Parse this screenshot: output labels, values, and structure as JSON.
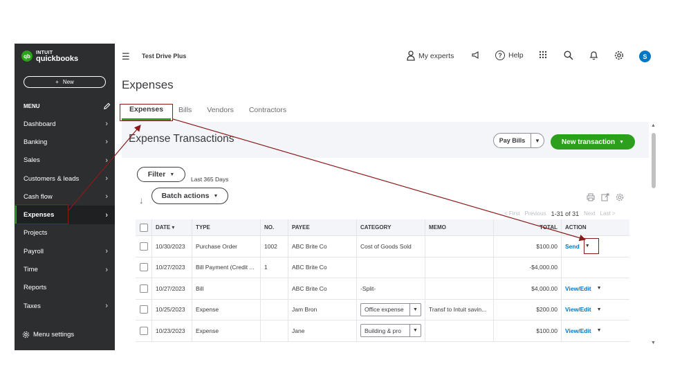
{
  "sidebar": {
    "logo_intuit": "INTUIT",
    "logo_product": "quickbooks",
    "logo_mark": "qb",
    "new_label": "New",
    "menu_label": "MENU",
    "items": [
      {
        "label": "Dashboard",
        "has_chevron": true
      },
      {
        "label": "Banking",
        "has_chevron": true
      },
      {
        "label": "Sales",
        "has_chevron": true
      },
      {
        "label": "Customers & leads",
        "has_chevron": true
      },
      {
        "label": "Cash flow",
        "has_chevron": true
      },
      {
        "label": "Expenses",
        "has_chevron": true,
        "active": true
      },
      {
        "label": "Projects",
        "has_chevron": false
      },
      {
        "label": "Payroll",
        "has_chevron": true
      },
      {
        "label": "Time",
        "has_chevron": true
      },
      {
        "label": "Reports",
        "has_chevron": false
      },
      {
        "label": "Taxes",
        "has_chevron": true
      }
    ],
    "menu_settings": "Menu settings"
  },
  "topbar": {
    "company": "Test Drive Plus",
    "my_experts": "My experts",
    "help": "Help",
    "avatar_letter": "S"
  },
  "page": {
    "title": "Expenses",
    "tabs": [
      "Expenses",
      "Bills",
      "Vendors",
      "Contractors"
    ],
    "active_tab": "Expenses"
  },
  "panel": {
    "title": "Expense Transactions",
    "pay_bills": "Pay Bills",
    "new_transaction": "New transaction"
  },
  "toolbar": {
    "filter": "Filter",
    "range": "Last 365 Days",
    "batch_actions": "Batch actions"
  },
  "pager": {
    "first": "< First",
    "previous": "Previous",
    "count": "1-31 of 31",
    "next": "Next",
    "last": "Last >"
  },
  "table": {
    "headers": {
      "date": "DATE ▾",
      "type": "TYPE",
      "no": "NO.",
      "payee": "PAYEE",
      "category": "CATEGORY",
      "memo": "MEMO",
      "total": "TOTAL",
      "action": "ACTION"
    },
    "rows": [
      {
        "date": "10/30/2023",
        "type": "Purchase Order",
        "no": "1002",
        "payee": "ABC Brite Co",
        "category": "Cost of Goods Sold",
        "category_select": false,
        "memo": "",
        "total": "$100.00",
        "action": "Send"
      },
      {
        "date": "10/27/2023",
        "type": "Bill Payment (Credit ...",
        "no": "1",
        "payee": "ABC Brite Co",
        "category": "",
        "category_select": false,
        "memo": "",
        "total": "-$4,000.00",
        "action": ""
      },
      {
        "date": "10/27/2023",
        "type": "Bill",
        "no": "",
        "payee": "ABC Brite Co",
        "category": "-Split-",
        "category_select": false,
        "memo": "",
        "total": "$4,000.00",
        "action": "View/Edit"
      },
      {
        "date": "10/25/2023",
        "type": "Expense",
        "no": "",
        "payee": "Jam Bron",
        "category": "Office expense",
        "category_select": true,
        "memo": "Transf to Intuit savin...",
        "total": "$200.00",
        "action": "View/Edit"
      },
      {
        "date": "10/23/2023",
        "type": "Expense",
        "no": "",
        "payee": "Jane",
        "category": "Building & pro",
        "category_select": true,
        "memo": "",
        "total": "$100.00",
        "action": "View/Edit"
      }
    ]
  },
  "colors": {
    "sidebar_bg": "#2d2e30",
    "brand_green": "#2ca01c",
    "link_blue": "#0077c5",
    "annotation_red": "#8b1a1a"
  },
  "icons": {
    "menu_toggle": "hamburger-icon",
    "experts": "person-icon",
    "feedback": "megaphone-icon",
    "apps": "grid-icon",
    "search": "search-icon",
    "notifications": "bell-icon",
    "settings": "gear-icon",
    "edit": "pencil-icon"
  }
}
